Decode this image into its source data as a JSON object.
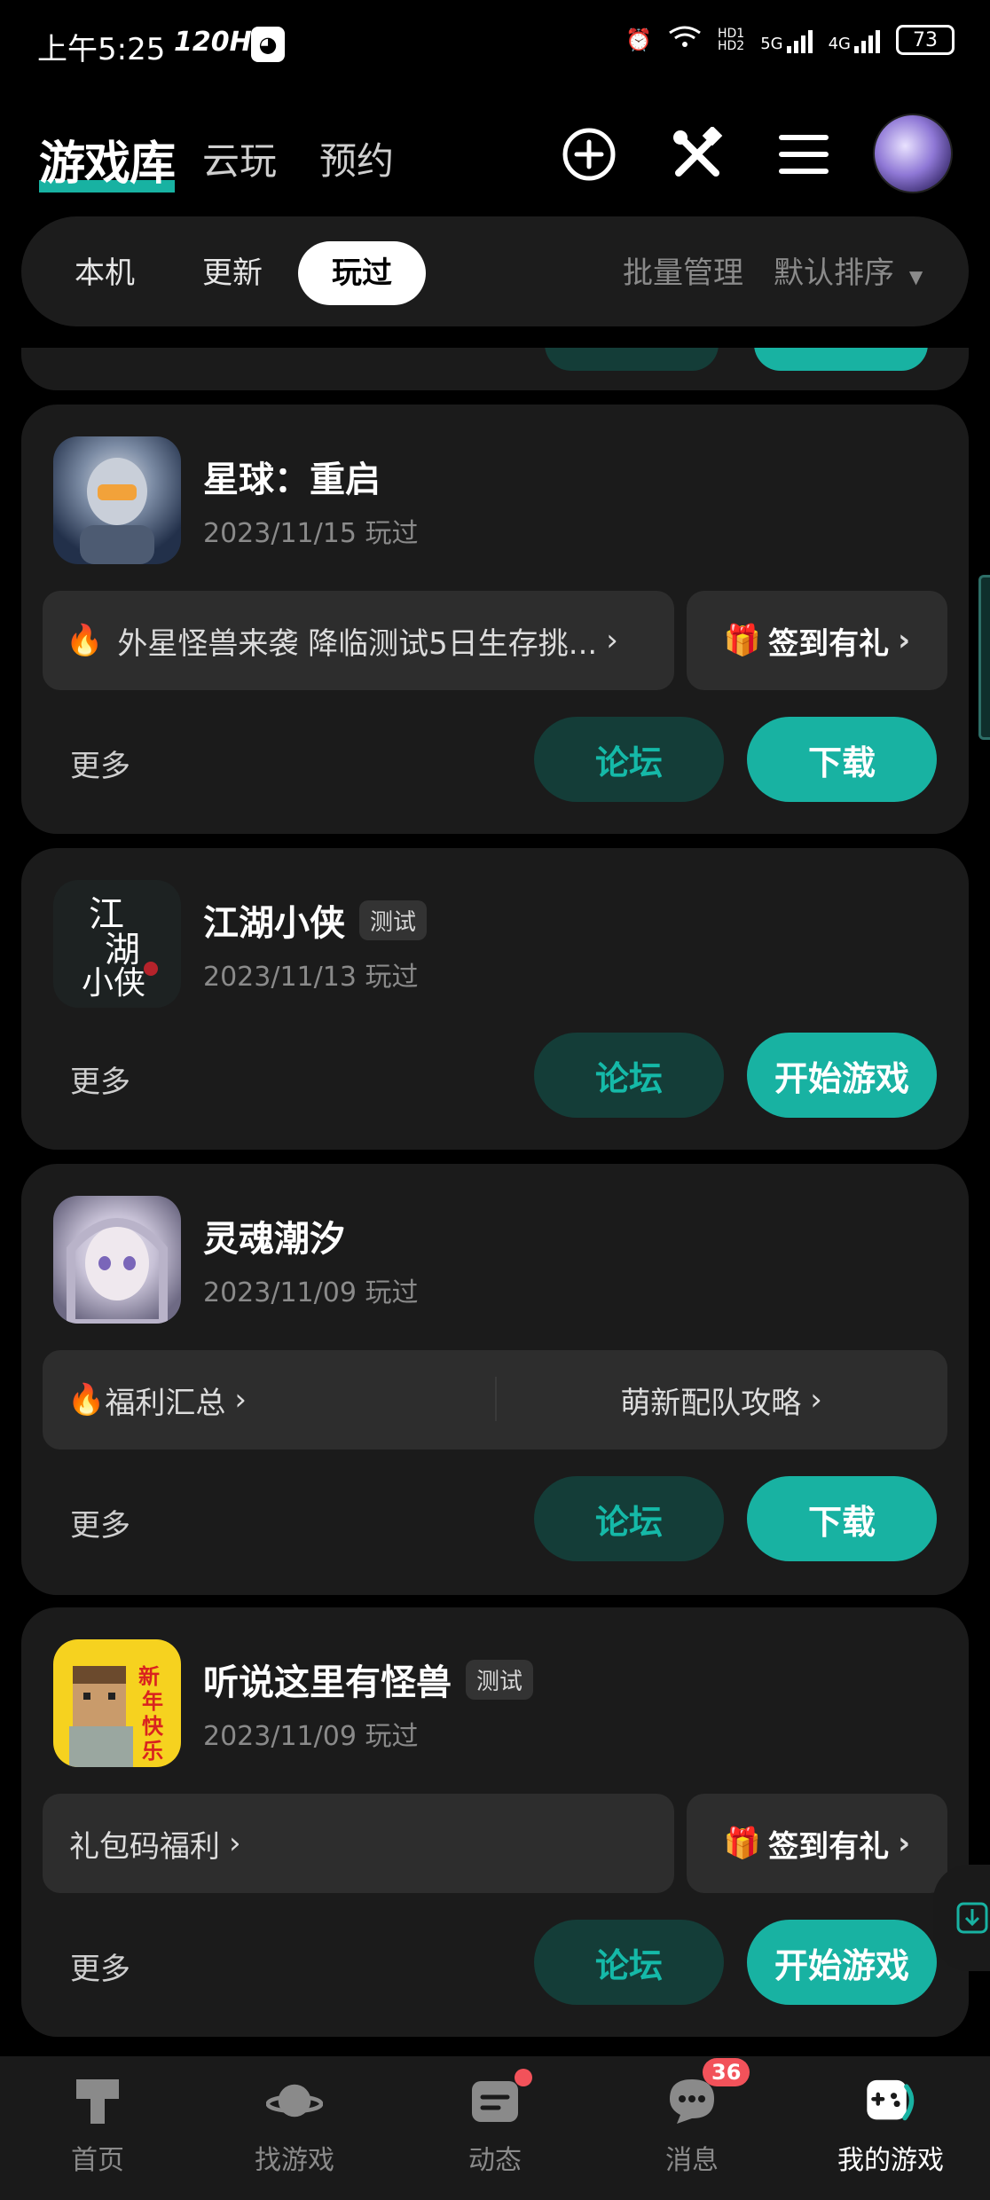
{
  "status_bar": {
    "time": "上午5:25",
    "refresh": "120Hz",
    "network_labels": [
      "HD1",
      "HD2",
      "5G",
      "4G"
    ],
    "battery": "73"
  },
  "header": {
    "title": "游戏库",
    "tabs": [
      "云玩",
      "预约"
    ],
    "icons": [
      "plus-circle-icon",
      "tools-icon",
      "menu-icon",
      "avatar"
    ]
  },
  "filter_bar": {
    "tabs": [
      {
        "label": "本机",
        "active": false
      },
      {
        "label": "更新",
        "active": false
      },
      {
        "label": "玩过",
        "active": true
      }
    ],
    "batch_manage": "批量管理",
    "sort": "默认排序"
  },
  "games": [
    {
      "title": "星球：重启",
      "tag": "",
      "date": "2023/11/15 玩过",
      "promo_left": "外星怪兽来袭 降临测试5日生存挑...",
      "promo_right": "签到有礼",
      "more": "更多",
      "forum": "论坛",
      "action": "下载"
    },
    {
      "title": "江湖小侠",
      "tag": "测试",
      "date": "2023/11/13 玩过",
      "more": "更多",
      "forum": "论坛",
      "action": "开始游戏"
    },
    {
      "title": "灵魂潮汐",
      "tag": "",
      "date": "2023/11/09 玩过",
      "promo_left": "福利汇总",
      "promo_right": "萌新配队攻略",
      "more": "更多",
      "forum": "论坛",
      "action": "下载"
    },
    {
      "title": "听说这里有怪兽",
      "tag": "测试",
      "date": "2023/11/09 玩过",
      "promo_left": "礼包码福利",
      "promo_right": "签到有礼",
      "more": "更多",
      "forum": "论坛",
      "action": "开始游戏"
    }
  ],
  "bottom_nav": [
    {
      "label": "首页",
      "icon": "home-icon"
    },
    {
      "label": "找游戏",
      "icon": "planet-icon"
    },
    {
      "label": "动态",
      "icon": "feed-icon"
    },
    {
      "label": "消息",
      "icon": "message-icon",
      "badge": "36"
    },
    {
      "label": "我的游戏",
      "icon": "my-games-icon",
      "active": true
    }
  ],
  "colors": {
    "accent": "#18b2a2",
    "forum_bg": "#143d38",
    "card_bg": "#1b1b1b",
    "badge": "#f2525a"
  }
}
